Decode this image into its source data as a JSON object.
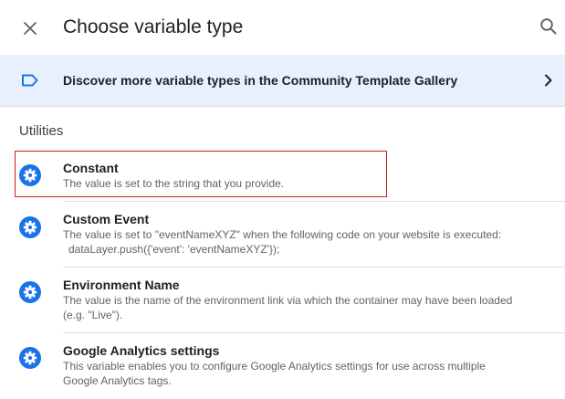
{
  "header": {
    "title": "Choose variable type",
    "close_icon": "close-icon",
    "search_icon": "search-icon"
  },
  "banner": {
    "text": "Discover more variable types in the Community Template Gallery",
    "icon": "tag-label-icon",
    "chevron": "chevron-right-icon",
    "background": "#e8f0fe",
    "icon_color": "#1a73e8"
  },
  "section": {
    "heading": "Utilities"
  },
  "colors": {
    "accent": "#1a73e8",
    "selection_outline": "#c5221f"
  },
  "items": [
    {
      "title": "Constant",
      "desc_lines": [
        "The value is set to the string that you provide."
      ],
      "icon": "gear-icon",
      "selected": true
    },
    {
      "title": "Custom Event",
      "desc_lines": [
        "The value is set to \"eventNameXYZ\" when the following code on your website is executed:",
        "dataLayer.push({'event': 'eventNameXYZ'});"
      ],
      "icon": "gear-icon",
      "selected": false
    },
    {
      "title": "Environment Name",
      "desc_lines": [
        "The value is the name of the environment link via which the container may have been loaded",
        "(e.g. \"Live\")."
      ],
      "icon": "gear-icon",
      "selected": false
    },
    {
      "title": "Google Analytics settings",
      "desc_lines": [
        "This variable enables you to configure Google Analytics settings for use across multiple",
        "Google Analytics tags."
      ],
      "icon": "gear-icon",
      "selected": false
    }
  ]
}
